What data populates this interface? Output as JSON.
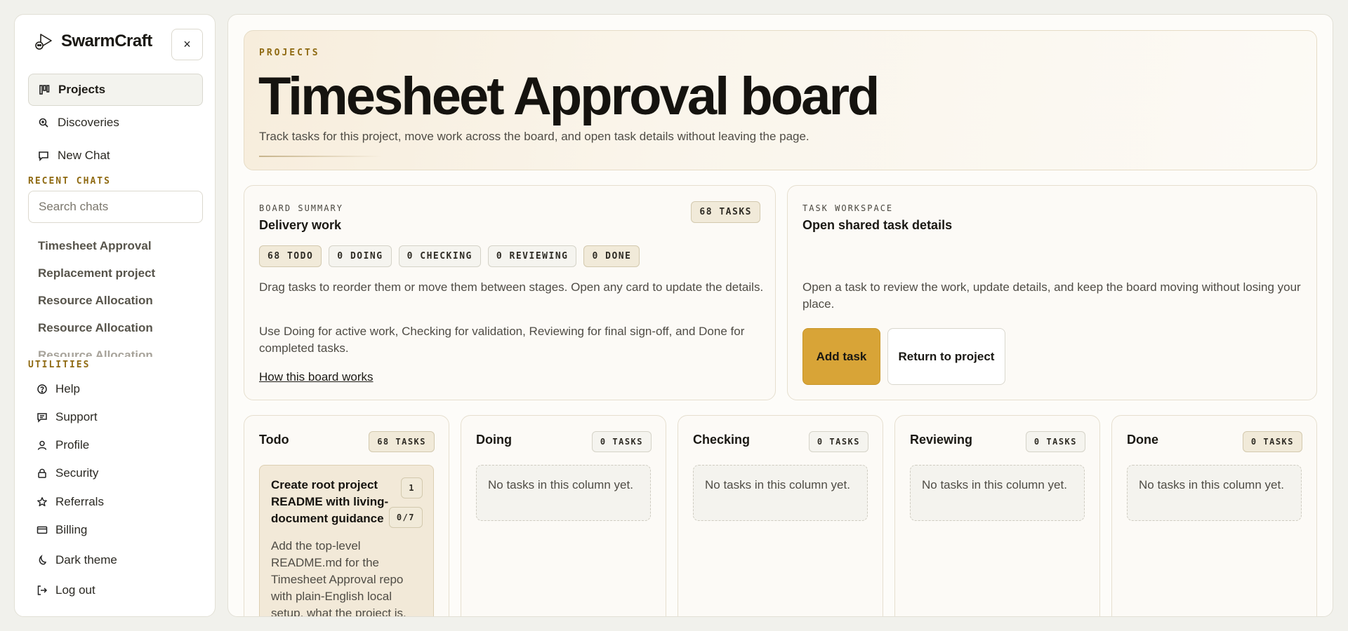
{
  "brand": {
    "name": "SwarmCraft"
  },
  "sidebar": {
    "close_label": "×",
    "nav": [
      {
        "label": "Projects",
        "icon": "kanban-icon"
      },
      {
        "label": "Discoveries",
        "icon": "search-zoom-icon"
      },
      {
        "label": "New Chat",
        "icon": "chat-bubble-icon"
      }
    ],
    "recent_label": "RECENT CHATS",
    "search_placeholder": "Search chats",
    "chats": [
      "Timesheet Approval",
      "Replacement project",
      "Resource Allocation",
      "Resource Allocation",
      "Resource Allocation"
    ],
    "utilities_label": "UTILITIES",
    "utilities": [
      {
        "label": "Help",
        "icon": "help-circle-icon"
      },
      {
        "label": "Support",
        "icon": "message-icon"
      },
      {
        "label": "Profile",
        "icon": "user-icon"
      },
      {
        "label": "Security",
        "icon": "lock-icon"
      },
      {
        "label": "Referrals",
        "icon": "star-icon"
      },
      {
        "label": "Billing",
        "icon": "credit-card-icon"
      },
      {
        "label": "Dark theme",
        "icon": "moon-icon"
      },
      {
        "label": "Log out",
        "icon": "logout-icon"
      }
    ]
  },
  "hero": {
    "eyebrow": "PROJECTS",
    "title": "Timesheet Approval board",
    "description": "Track tasks for this project, move work across the board, and open task details without leaving the page."
  },
  "summary": {
    "eyebrow": "BOARD SUMMARY",
    "title": "Delivery work",
    "count": "68 TASKS",
    "stages": [
      "68 TODO",
      "0 DOING",
      "0 CHECKING",
      "0 REVIEWING",
      "0 DONE"
    ],
    "p1": "Drag tasks to reorder them or move them between stages. Open any card to update the details.",
    "p2": "Use Doing for active work, Checking for validation, Reviewing for final sign-off, and Done for completed tasks.",
    "link": "How this board works"
  },
  "workspace": {
    "eyebrow": "TASK WORKSPACE",
    "title": "Open shared task details",
    "description": "Open a task to review the work, update details, and keep the board moving without losing your place.",
    "add_label": "Add task",
    "return_label": "Return to project"
  },
  "columns": [
    {
      "title": "Todo",
      "count": "68 TASKS"
    },
    {
      "title": "Doing",
      "count": "0 TASKS",
      "empty": "No tasks in this column yet."
    },
    {
      "title": "Checking",
      "count": "0 TASKS",
      "empty": "No tasks in this column yet."
    },
    {
      "title": "Reviewing",
      "count": "0 TASKS",
      "empty": "No tasks in this column yet."
    },
    {
      "title": "Done",
      "count": "0 TASKS",
      "empty": "No tasks in this column yet."
    }
  ],
  "task": {
    "title": "Create root project README with living-document guidance",
    "order": "1",
    "progress": "0/7",
    "description": "Add the top-level README.md for the Timesheet Approval repo with plain-English local setup, what the project is,"
  },
  "colors": {
    "accent": "#d8a437",
    "eyebrow": "#8f6a12"
  }
}
